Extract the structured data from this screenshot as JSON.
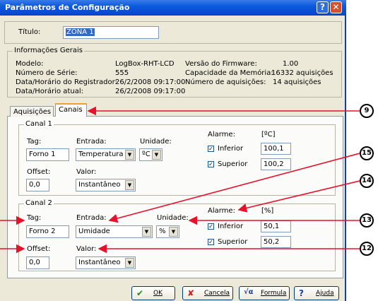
{
  "window": {
    "title": "Parâmetros de Configuração",
    "help_glyph": "?",
    "close_glyph": "✕"
  },
  "titulo": {
    "label": "Título:",
    "value": "ZONA 1"
  },
  "info": {
    "heading": "Informações Gerais",
    "rows": [
      {
        "label": "Modelo:",
        "value": "LogBox-RHT-LCD"
      },
      {
        "label": "Número de Série:",
        "value": "555"
      },
      {
        "label": "Data/Horário do Registrador:",
        "value": "26/2/2008 09:17:00"
      },
      {
        "label": "Data/Horário atual:",
        "value": "26/2/2008 09:17:00"
      }
    ],
    "right_rows": [
      {
        "label": "Versão do Firmware:",
        "value": "1.00"
      },
      {
        "label": "Capacidade da Memória:",
        "value": "16332 aquisições"
      },
      {
        "label": "Número de aquisições:",
        "value": "14 aquisições"
      }
    ]
  },
  "tabs": [
    {
      "label": "Aquisições"
    },
    {
      "label": "Canais"
    }
  ],
  "canal1": {
    "heading": "Canal 1",
    "tag_label": "Tag:",
    "tag_value": "Forno 1",
    "entrada_label": "Entrada:",
    "entrada_value": "Temperatura",
    "unidade_label": "Unidade:",
    "unidade_value": "ºC",
    "offset_label": "Offset:",
    "offset_value": "0,0",
    "valor_label": "Valor:",
    "valor_value": "Instantâneo",
    "alarme_label": "Alarme:",
    "alarme_unit": "[ºC]",
    "inferior_label": "Inferior",
    "inferior_value": "100,1",
    "superior_label": "Superior",
    "superior_value": "100,2"
  },
  "canal2": {
    "heading": "Canal 2",
    "tag_label": "Tag:",
    "tag_value": "Forno 2",
    "entrada_label": "Entrada:",
    "entrada_value": "Umidade",
    "unidade_label": "Unidade:",
    "unidade_value": "%",
    "offset_label": "Offset:",
    "offset_value": "0,0",
    "valor_label": "Valor:",
    "valor_value": "Instantâneo",
    "alarme_label": "Alarme:",
    "alarme_unit": "[%]",
    "inferior_label": "Inferior",
    "inferior_value": "50,1",
    "superior_label": "Superior",
    "superior_value": "50,2"
  },
  "checkmark": "✓",
  "dropdown_glyph": "▼",
  "buttons": [
    {
      "label": "OK",
      "icon": "✔",
      "icon_name": "check-icon",
      "color": "#1a8c1a"
    },
    {
      "label": "Cancela",
      "icon": "✘",
      "icon_name": "cross-icon",
      "color": "#c81e1e"
    },
    {
      "label": "Formula",
      "icon": "√α",
      "icon_name": "formula-icon",
      "color": "#2040a0"
    },
    {
      "label": "Ajuda",
      "icon": "?",
      "icon_name": "help-icon",
      "color": "#1a3ca8"
    }
  ],
  "callouts": [
    "9",
    "15",
    "14",
    "13",
    "12"
  ],
  "colors": {
    "arrow": "#e8102a",
    "title_bar": "#0a5ae0"
  }
}
